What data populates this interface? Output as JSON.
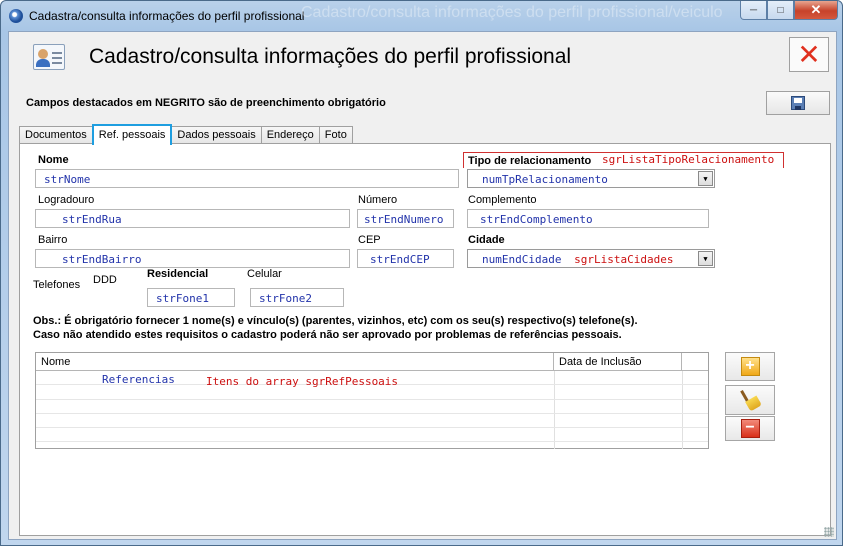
{
  "window": {
    "title": "Cadastra/consulta informações do perfil profissional",
    "ghost_title": "Cadastro/consulta informações do perfil profissional/veiculo",
    "minimize": "─",
    "maximize": "□",
    "close": "✕"
  },
  "header": {
    "title": "Cadastro/consulta informações do perfil profissional",
    "close_glyph": "✕",
    "required_note": "Campos destacados em NEGRITO são de preenchimento obrigatório"
  },
  "tabs": [
    "Documentos",
    "Ref. pessoais",
    "Dados pessoais",
    "Endereço",
    "Foto"
  ],
  "form": {
    "nome_label": "Nome",
    "nome_value": "strNome",
    "tipo_label": "Tipo de relacionamento",
    "tipo_list": "sgrListaTipoRelacionamento",
    "tipo_value": "numTpRelacionamento",
    "logradouro_label": "Logradouro",
    "logradouro_value": "strEndRua",
    "numero_label": "Número",
    "numero_value": "strEndNumero",
    "complemento_label": "Complemento",
    "complemento_value": "strEndComplemento",
    "bairro_label": "Bairro",
    "bairro_value": "strEndBairro",
    "cep_label": "CEP",
    "cep_value": "strEndCEP",
    "cidade_label": "Cidade",
    "cidade_value": "numEndCidade",
    "cidade_list": "sgrListaCidades",
    "telefones_label": "Telefones",
    "ddd_label": "DDD",
    "residencial_label": "Residencial",
    "residencial_value": "strFone1",
    "celular_label": "Celular",
    "celular_value": "strFone2"
  },
  "obs": {
    "line1": "Obs.: É obrigatório fornecer 1 nome(s) e vínculo(s) (parentes, vizinhos, etc) com os seu(s) respectivo(s) telefone(s).",
    "line2": "Caso não atendido estes requisitos o cadastro poderá não ser aprovado por problemas de referências pessoais."
  },
  "grid": {
    "columns": [
      "Nome",
      "Data de Inclusão"
    ],
    "rows": [
      {
        "nome": "Referencias",
        "note": "Itens do array sgrRefPessoais",
        "data": ""
      }
    ]
  },
  "side_buttons": {
    "add": "+",
    "remove": "−"
  },
  "colors": {
    "accent_tab": "#1e9ee0",
    "field_text": "#2233aa",
    "annotation_red": "#cc1010"
  }
}
